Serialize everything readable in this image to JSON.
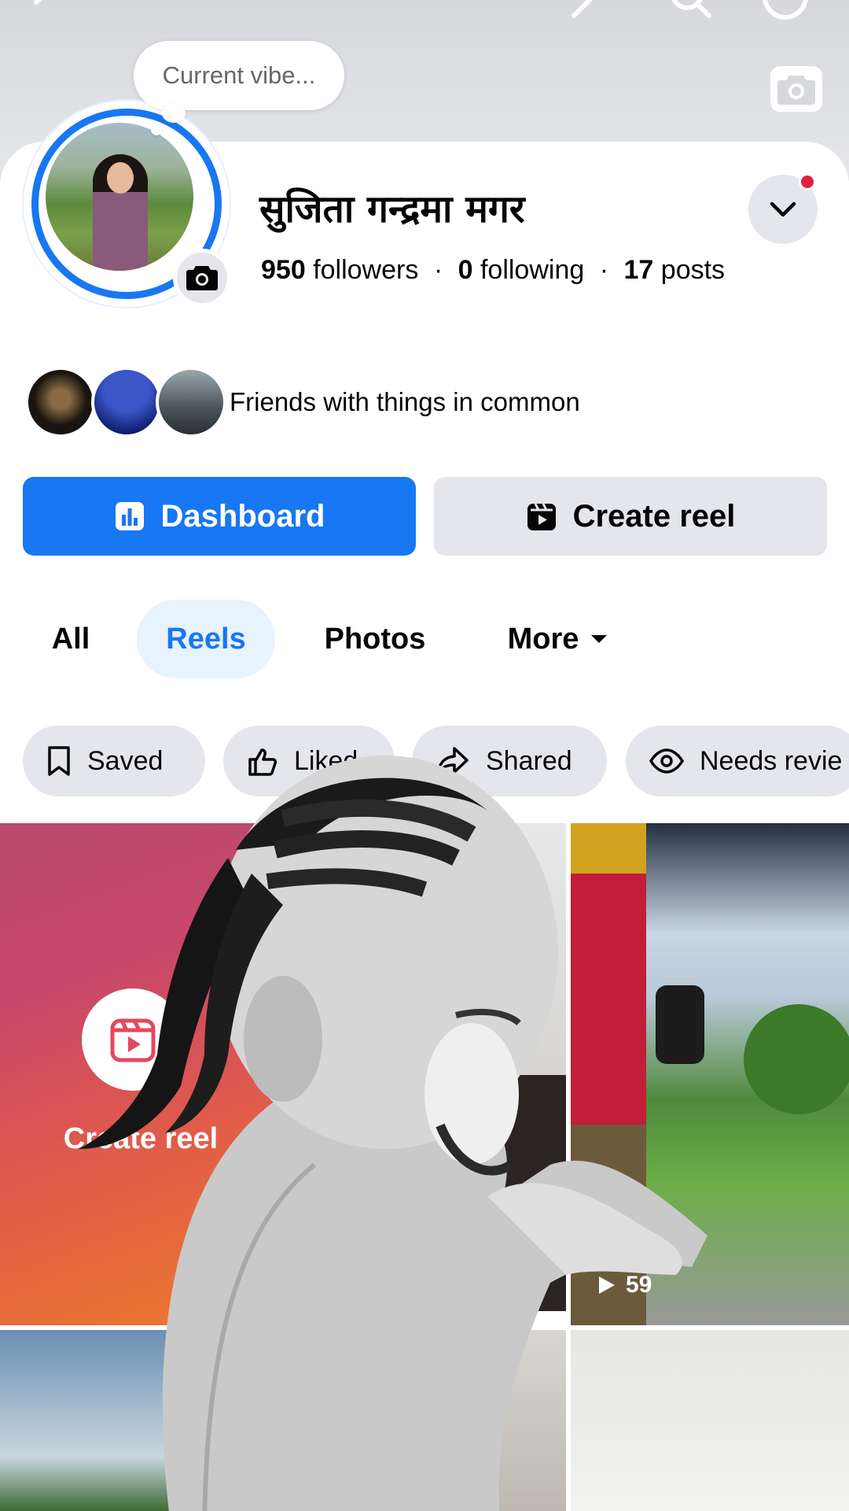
{
  "profile": {
    "vibe_prompt": "Current vibe...",
    "name": "सुजिता गन्द्रमा मगर",
    "followers_count": "950",
    "followers_label": "followers",
    "following_count": "0",
    "following_label": "following",
    "posts_count": "17",
    "posts_label": "posts"
  },
  "friends": {
    "label": "Friends with things in common"
  },
  "actions": {
    "dashboard_label": "Dashboard",
    "create_reel_label": "Create reel"
  },
  "tabs": [
    {
      "label": "All"
    },
    {
      "label": "Reels"
    },
    {
      "label": "Photos"
    },
    {
      "label": "More"
    }
  ],
  "filters": [
    {
      "label": "Saved"
    },
    {
      "label": "Liked"
    },
    {
      "label": "Shared"
    },
    {
      "label": "Needs revie"
    }
  ],
  "grid": {
    "create_label": "Create reel",
    "reel_views": "59"
  },
  "colors": {
    "accent": "#1877f2",
    "chip_bg": "#e4e6eb",
    "notification": "#e41e3f"
  }
}
